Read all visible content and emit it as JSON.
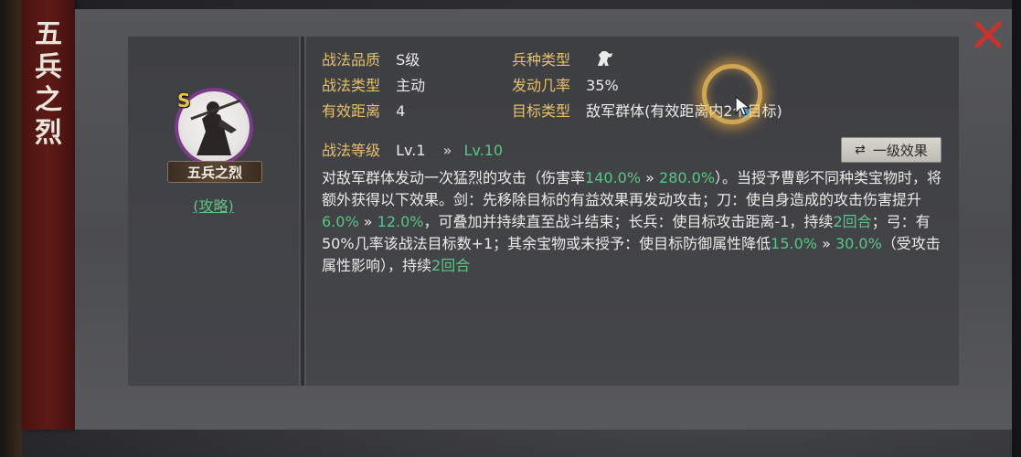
{
  "banner": {
    "title_chars": [
      "五",
      "兵",
      "之",
      "烈"
    ]
  },
  "skill": {
    "grade_badge": "S",
    "name": "五兵之烈",
    "guide_link": "(攻略)"
  },
  "info": {
    "quality_label": "战法品质",
    "quality_value": "S级",
    "troop_label": "兵种类型",
    "troop_icon": "horse-icon",
    "type_label": "战法类型",
    "type_value": "主动",
    "rate_label": "发动几率",
    "rate_value": "35%",
    "range_label": "有效距离",
    "range_value": "4",
    "target_label": "目标类型",
    "target_value": "敌军群体(有效距离内2个目标)"
  },
  "level": {
    "label": "战法等级",
    "current": "Lv.1",
    "arrow": "»",
    "max": "Lv.10"
  },
  "effect_button": {
    "icon": "swap-arrows-icon",
    "label": "一级效果"
  },
  "description": {
    "p1": "对敌军群体发动一次猛烈的攻击（伤害率",
    "v1a": "140.0%",
    "arrow": "»",
    "v1b": "280.0%",
    "p2": "）。当授予曹彰不同种类宝物时，将额外获得以下效果。剑：先移除目标的有益效果再发动攻击；刀：使自身造成的攻击伤害提升",
    "v2a": "6.0%",
    "v2b": "12.0%",
    "p3": "，可叠加并持续直至战斗结束；长兵：使目标攻击距离-1，持续",
    "v3": "2回合",
    "p4": "；弓：有50%几率该战法目标数+1；其余宝物或未授予：使目标防御属性降低",
    "v4a": "15.0%",
    "v4b": "30.0%",
    "p5": "（受攻击属性影响），持续",
    "v5": "2回合"
  },
  "colors": {
    "accent_green": "#57c785",
    "label_gold": "#e6c06a",
    "close_red": "#c9332b",
    "banner_red": "#5e1a15",
    "avatar_ring": "#7b3b8b"
  }
}
